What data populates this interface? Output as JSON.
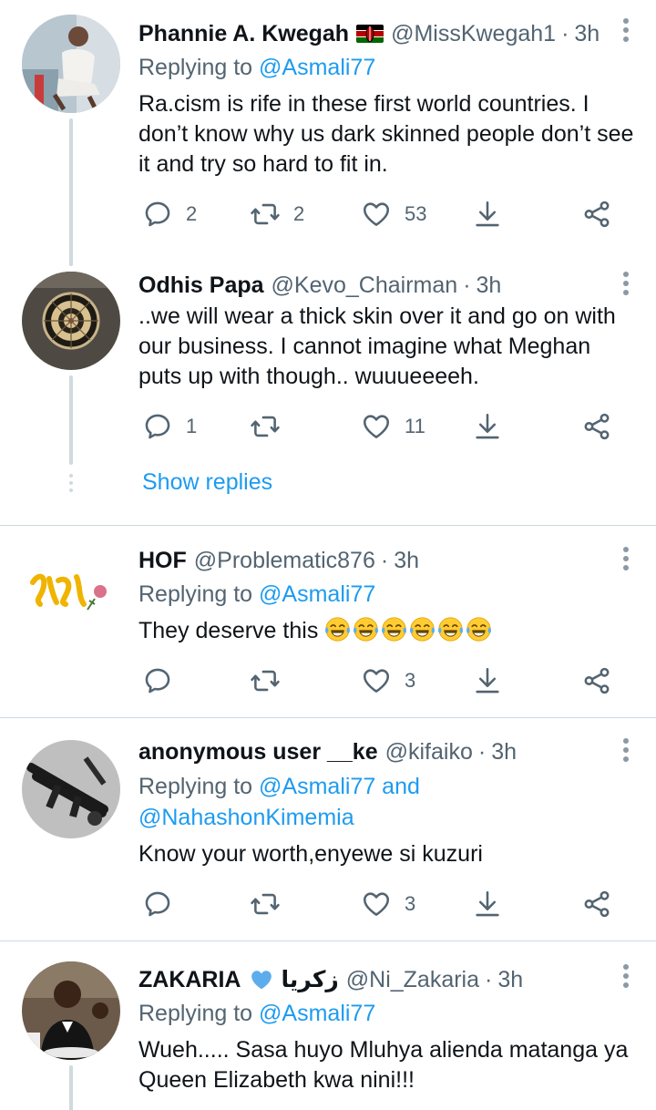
{
  "tweets": [
    {
      "name": "Phannie A. Kwegah",
      "handle": "@MissKwegah1",
      "sep": "·",
      "time": "3h",
      "reply_prefix": "Replying to ",
      "reply_mentions": "@Asmali77",
      "text_lines": [
        "Ra.cism is rife in these first world countries. I",
        "don’t know why us dark skinned people don’t see",
        "it and try so hard to fit in."
      ],
      "replies": "2",
      "retweets": "2",
      "likes": "53"
    },
    {
      "name": "Odhis Papa",
      "handle": "@Kevo_Chairman",
      "sep": "·",
      "time": "3h",
      "text_lines": [
        "..we will wear a thick skin over it and go on with",
        "our business. I cannot imagine what Meghan",
        "puts up with though.. wuuueeeeh."
      ],
      "replies": "1",
      "retweets": "",
      "likes": "11",
      "show_replies": "Show replies"
    },
    {
      "name": "HOF",
      "handle": "@Problematic876",
      "sep": "·",
      "time": "3h",
      "reply_prefix": "Replying to ",
      "reply_mentions": "@Asmali77",
      "text": "They deserve this",
      "emoji": "face-with-tears-of-joy x6",
      "replies": "",
      "retweets": "",
      "likes": "3"
    },
    {
      "name": "anonymous user __ke",
      "handle": "@kifaiko",
      "sep": "·",
      "time": "3h",
      "reply_prefix": "Replying to ",
      "reply_mentions_line1": "@Asmali77 and",
      "reply_mentions_line2": "@NahashonKimemia",
      "text": "Know your worth,enyewe si kuzuri",
      "replies": "",
      "retweets": "",
      "likes": "3"
    },
    {
      "name": "ZAKARIA",
      "arabic_name": "زكريا",
      "handle": "@Ni_Zakaria",
      "sep": "·",
      "time": "3h",
      "reply_prefix": "Replying to ",
      "reply_mentions": "@Asmali77",
      "text_lines": [
        "Wueh..... Sasa huyo Mluhya aliendа matanga ya",
        "Queen Elizabeth kwa nini!!!"
      ]
    }
  ],
  "icons": {
    "reply": "reply-icon",
    "retweet": "retweet-icon",
    "like": "like-icon",
    "bookmark": "download-icon",
    "share": "share-icon",
    "more": "more-options-icon"
  },
  "colors": {
    "link": "#1d9bf0",
    "secondary": "#536471",
    "divider": "#cfd9de",
    "verified_heart": "#1d9bf0"
  }
}
